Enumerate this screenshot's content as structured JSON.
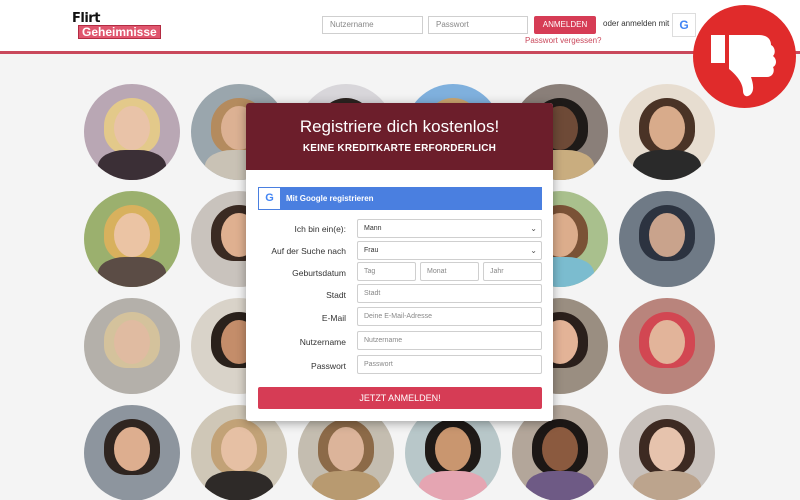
{
  "header": {
    "logo_top": "Flirt",
    "logo_bottom": "Geheimnisse",
    "username_placeholder": "Nutzername",
    "password_placeholder": "Passwort",
    "login_button": "ANMELDEN",
    "or_login_with": "oder anmelden mit",
    "google_letter": "G",
    "forgot_password": "Passwort vergessen?"
  },
  "badge": {
    "icon": "thumbs-down-icon",
    "color": "#e02b2b"
  },
  "signup": {
    "title": "Registriere dich kostenlos!",
    "subtitle": "KEINE KREDITKARTE ERFORDERLICH",
    "google_button": "Mit Google registrieren",
    "google_letter": "G",
    "fields": {
      "iam_label": "Ich bin ein(e):",
      "iam_value": "Mann",
      "seeking_label": "Auf der Suche nach",
      "seeking_value": "Frau",
      "birthdate_label": "Geburtsdatum",
      "day_placeholder": "Tag",
      "month_placeholder": "Monat",
      "year_placeholder": "Jahr",
      "city_label": "Stadt",
      "city_placeholder": "Stadt",
      "email_label": "E-Mail",
      "email_placeholder": "Deine E-Mail-Adresse",
      "username_label": "Nutzername",
      "username_placeholder": "Nutzername",
      "password_label": "Passwort",
      "password_placeholder": "Passwort"
    },
    "submit": "JETZT ANMELDEN!"
  },
  "colors": {
    "accent": "#d63c55",
    "modal_header": "#6c1e2b",
    "google_blue": "#4a7fe0"
  }
}
